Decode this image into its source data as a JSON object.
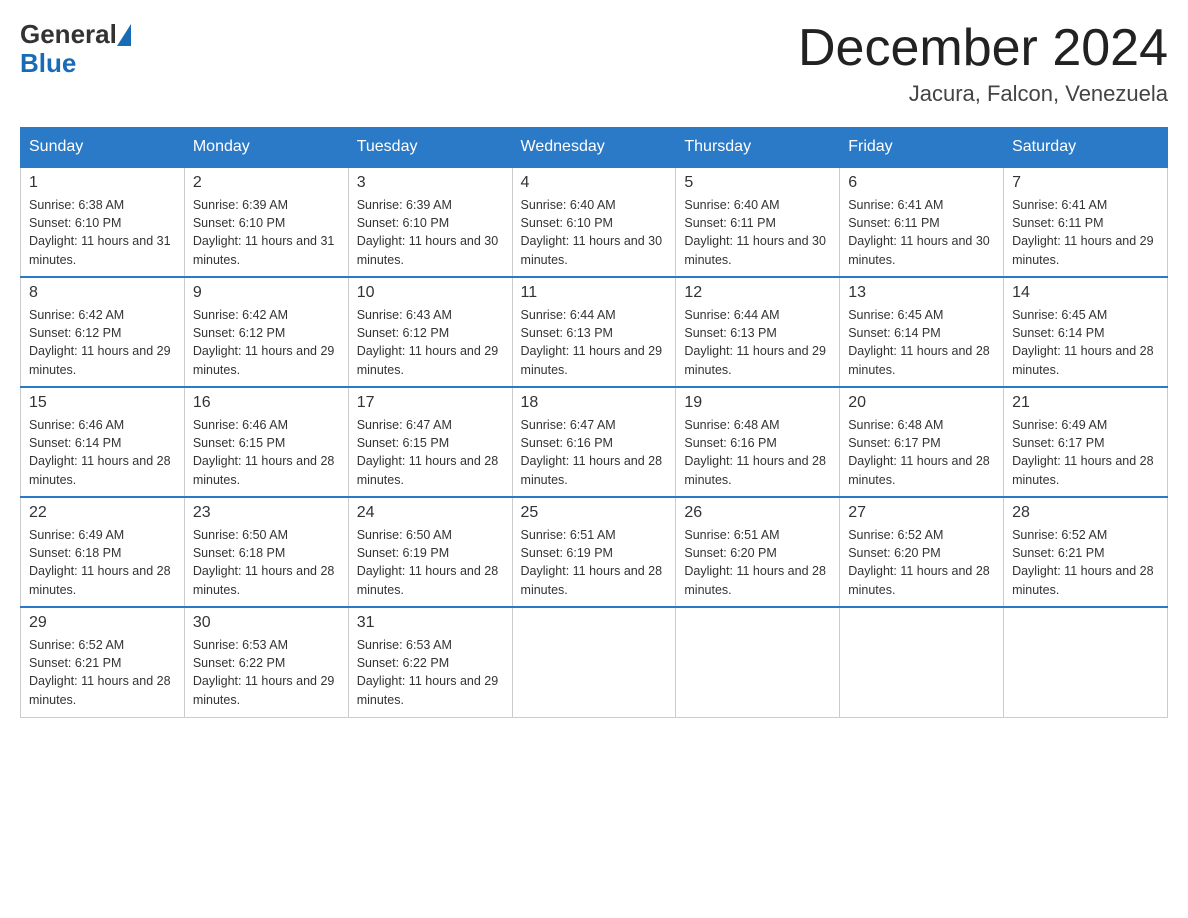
{
  "header": {
    "logo_general": "General",
    "logo_blue": "Blue",
    "month_title": "December 2024",
    "location": "Jacura, Falcon, Venezuela"
  },
  "days_of_week": [
    "Sunday",
    "Monday",
    "Tuesday",
    "Wednesday",
    "Thursday",
    "Friday",
    "Saturday"
  ],
  "weeks": [
    [
      {
        "day": "1",
        "sunrise": "6:38 AM",
        "sunset": "6:10 PM",
        "daylight": "11 hours and 31 minutes."
      },
      {
        "day": "2",
        "sunrise": "6:39 AM",
        "sunset": "6:10 PM",
        "daylight": "11 hours and 31 minutes."
      },
      {
        "day": "3",
        "sunrise": "6:39 AM",
        "sunset": "6:10 PM",
        "daylight": "11 hours and 30 minutes."
      },
      {
        "day": "4",
        "sunrise": "6:40 AM",
        "sunset": "6:10 PM",
        "daylight": "11 hours and 30 minutes."
      },
      {
        "day": "5",
        "sunrise": "6:40 AM",
        "sunset": "6:11 PM",
        "daylight": "11 hours and 30 minutes."
      },
      {
        "day": "6",
        "sunrise": "6:41 AM",
        "sunset": "6:11 PM",
        "daylight": "11 hours and 30 minutes."
      },
      {
        "day": "7",
        "sunrise": "6:41 AM",
        "sunset": "6:11 PM",
        "daylight": "11 hours and 29 minutes."
      }
    ],
    [
      {
        "day": "8",
        "sunrise": "6:42 AM",
        "sunset": "6:12 PM",
        "daylight": "11 hours and 29 minutes."
      },
      {
        "day": "9",
        "sunrise": "6:42 AM",
        "sunset": "6:12 PM",
        "daylight": "11 hours and 29 minutes."
      },
      {
        "day": "10",
        "sunrise": "6:43 AM",
        "sunset": "6:12 PM",
        "daylight": "11 hours and 29 minutes."
      },
      {
        "day": "11",
        "sunrise": "6:44 AM",
        "sunset": "6:13 PM",
        "daylight": "11 hours and 29 minutes."
      },
      {
        "day": "12",
        "sunrise": "6:44 AM",
        "sunset": "6:13 PM",
        "daylight": "11 hours and 29 minutes."
      },
      {
        "day": "13",
        "sunrise": "6:45 AM",
        "sunset": "6:14 PM",
        "daylight": "11 hours and 28 minutes."
      },
      {
        "day": "14",
        "sunrise": "6:45 AM",
        "sunset": "6:14 PM",
        "daylight": "11 hours and 28 minutes."
      }
    ],
    [
      {
        "day": "15",
        "sunrise": "6:46 AM",
        "sunset": "6:14 PM",
        "daylight": "11 hours and 28 minutes."
      },
      {
        "day": "16",
        "sunrise": "6:46 AM",
        "sunset": "6:15 PM",
        "daylight": "11 hours and 28 minutes."
      },
      {
        "day": "17",
        "sunrise": "6:47 AM",
        "sunset": "6:15 PM",
        "daylight": "11 hours and 28 minutes."
      },
      {
        "day": "18",
        "sunrise": "6:47 AM",
        "sunset": "6:16 PM",
        "daylight": "11 hours and 28 minutes."
      },
      {
        "day": "19",
        "sunrise": "6:48 AM",
        "sunset": "6:16 PM",
        "daylight": "11 hours and 28 minutes."
      },
      {
        "day": "20",
        "sunrise": "6:48 AM",
        "sunset": "6:17 PM",
        "daylight": "11 hours and 28 minutes."
      },
      {
        "day": "21",
        "sunrise": "6:49 AM",
        "sunset": "6:17 PM",
        "daylight": "11 hours and 28 minutes."
      }
    ],
    [
      {
        "day": "22",
        "sunrise": "6:49 AM",
        "sunset": "6:18 PM",
        "daylight": "11 hours and 28 minutes."
      },
      {
        "day": "23",
        "sunrise": "6:50 AM",
        "sunset": "6:18 PM",
        "daylight": "11 hours and 28 minutes."
      },
      {
        "day": "24",
        "sunrise": "6:50 AM",
        "sunset": "6:19 PM",
        "daylight": "11 hours and 28 minutes."
      },
      {
        "day": "25",
        "sunrise": "6:51 AM",
        "sunset": "6:19 PM",
        "daylight": "11 hours and 28 minutes."
      },
      {
        "day": "26",
        "sunrise": "6:51 AM",
        "sunset": "6:20 PM",
        "daylight": "11 hours and 28 minutes."
      },
      {
        "day": "27",
        "sunrise": "6:52 AM",
        "sunset": "6:20 PM",
        "daylight": "11 hours and 28 minutes."
      },
      {
        "day": "28",
        "sunrise": "6:52 AM",
        "sunset": "6:21 PM",
        "daylight": "11 hours and 28 minutes."
      }
    ],
    [
      {
        "day": "29",
        "sunrise": "6:52 AM",
        "sunset": "6:21 PM",
        "daylight": "11 hours and 28 minutes."
      },
      {
        "day": "30",
        "sunrise": "6:53 AM",
        "sunset": "6:22 PM",
        "daylight": "11 hours and 29 minutes."
      },
      {
        "day": "31",
        "sunrise": "6:53 AM",
        "sunset": "6:22 PM",
        "daylight": "11 hours and 29 minutes."
      },
      null,
      null,
      null,
      null
    ]
  ]
}
